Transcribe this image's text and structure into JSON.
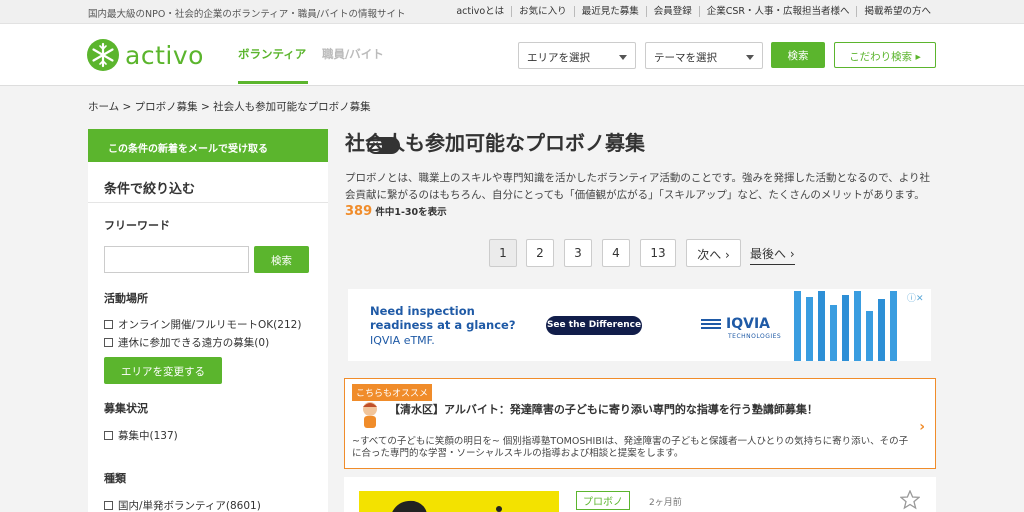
{
  "top": {
    "tagline": "国内最大級のNPO・社会的企業のボランティア・職員/バイトの情報サイト",
    "links": [
      "activoとは",
      "お気に入り",
      "最近見た募集",
      "会員登録",
      "企業CSR・人事・広報担当者様へ",
      "掲載希望の方へ"
    ]
  },
  "header": {
    "logo": "activo",
    "nav_volunteer": "ボランティア",
    "nav_job": "職員/バイト",
    "area_select": "エリアを選択",
    "theme_select": "テーマを選択",
    "search_button": "検索",
    "advanced_button": "こだわり検索 ▸"
  },
  "breadcrumb": "ホーム > プロボノ募集 > 社会人も参加可能なプロボノ募集",
  "sidebar": {
    "alert_label": "この条件の新着をメールで受け取る",
    "filter_title": "条件で絞り込む",
    "freeword_label": "フリーワード",
    "search_button": "検索",
    "location_label": "活動場所",
    "location_options": [
      "オンライン開催/フルリモートOK(212)",
      "連休に参加できる遠方の募集(0)"
    ],
    "change_area_button": "エリアを変更する",
    "status_label": "募集状況",
    "status_options": [
      "募集中(137)"
    ],
    "type_label": "種類",
    "type_options": [
      "国内/単発ボランティア(8601)"
    ]
  },
  "main": {
    "title": "社会人も参加可能なプロボノ募集",
    "description": "プロボノとは、職業上のスキルや専門知識を活かしたボランティア活動のことです。強みを発揮した活動となるので、より社会貢献に繋がるのはもちろん、自分にとっても「価値観が広がる」「スキルアップ」など、たくさんのメリットがあります。",
    "count": "389",
    "count_label": "件中1-30を表示",
    "pages": [
      "1",
      "2",
      "3",
      "4",
      "13"
    ],
    "next": "次へ ›",
    "last": "最後へ ›"
  },
  "ad": {
    "line1": "Need inspection",
    "line2": "readiness at a glance?",
    "line3": "IQVIA eTMF.",
    "button": "See the Difference",
    "brand": "IQVIA",
    "brand_sub": "TECHNOLOGIES"
  },
  "recommend": {
    "badge": "こちらもオススメ",
    "title": "【清水区】アルバイト：発達障害の子どもに寄り添い専門的な指導を行う塾講師募集！",
    "body": "~すべての子どもに笑顔の明日を~ 個別指導塾TOMOSHIBIは、発達障害の子どもと保護者一人ひとりの気持ちに寄り添い、その子に合った専門的な学習・ソーシャルスキルの指導および相談と提案をします。"
  },
  "card": {
    "tag": "プロボノ",
    "time": "2ヶ月前"
  },
  "colors": {
    "brand_green": "#5bb52d",
    "accent_orange": "#f08c2a"
  }
}
